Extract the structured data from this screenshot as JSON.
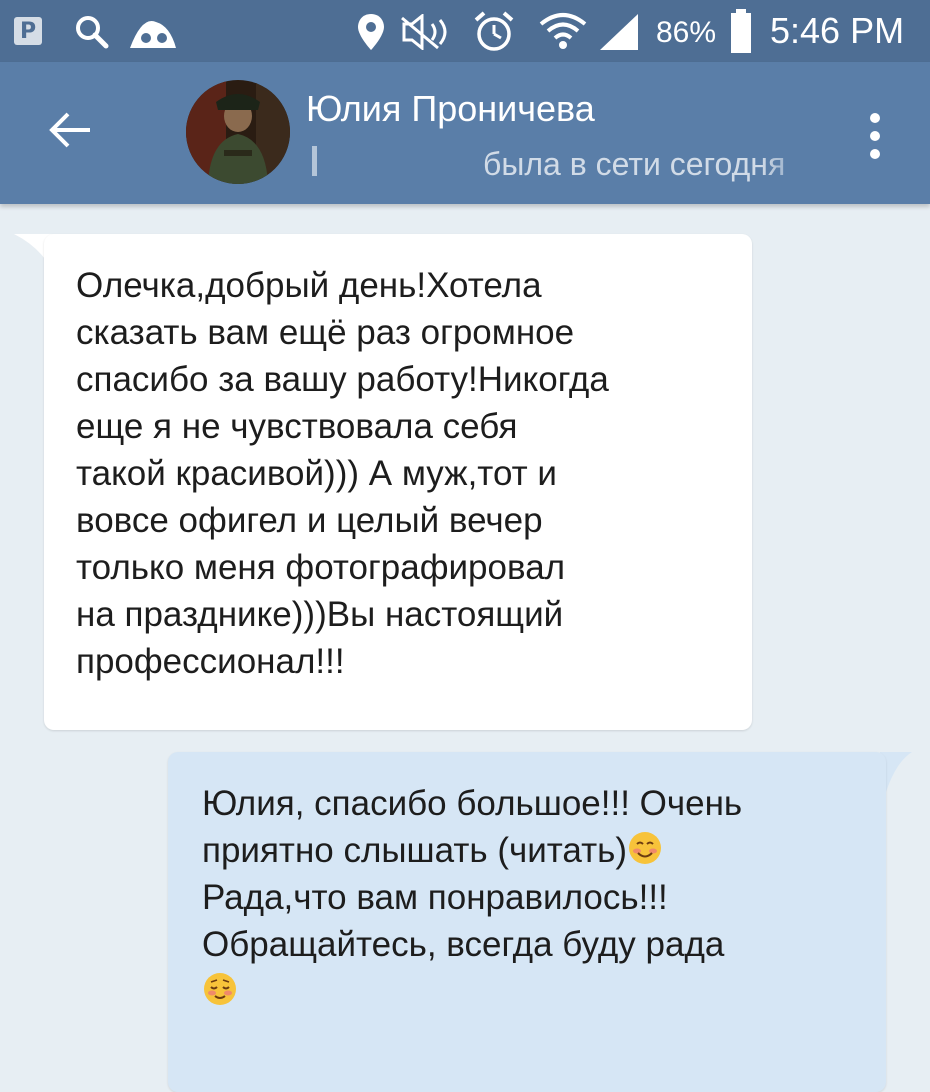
{
  "status_bar": {
    "battery": "86%",
    "time": "5:46 PM",
    "icons": [
      "p-notification-icon",
      "search-icon",
      "app-notification-icon",
      "location-icon",
      "mute-icon",
      "alarm-icon",
      "wifi-icon",
      "signal-icon",
      "battery-icon"
    ]
  },
  "header": {
    "back_icon": "back-arrow-icon",
    "contact_name": "Юлия Проничева",
    "contact_status": "была в сети сегодня",
    "menu_icon": "more-vertical-icon"
  },
  "messages": [
    {
      "direction": "incoming",
      "text": "Олечка,добрый день!Хотела\nсказать вам ещё раз огромное\nспасибо за вашу работу!Никогда\nеще я не чувствовала себя\nтакой красивой))) А муж,тот и\nвовсе офигел и целый вечер\nтолько меня фотографировал\nна празднике)))Вы настоящий\nпрофессионал!!!"
    },
    {
      "direction": "outgoing",
      "line1": "Юлия, спасибо большое!!! Очень",
      "line2": "приятно слышать (читать)",
      "line3": "Рада,что вам понравилось!!!",
      "line4": "Обращайтесь, всегда буду рада",
      "emoji_1": "smiling-face-emoji",
      "emoji_2": "relieved-face-emoji"
    }
  ],
  "colors": {
    "status_bar": "#4e6e94",
    "header": "#5a7ea8",
    "background": "#e7eef3",
    "incoming_bubble": "#ffffff",
    "outgoing_bubble": "#d6e6f5"
  }
}
